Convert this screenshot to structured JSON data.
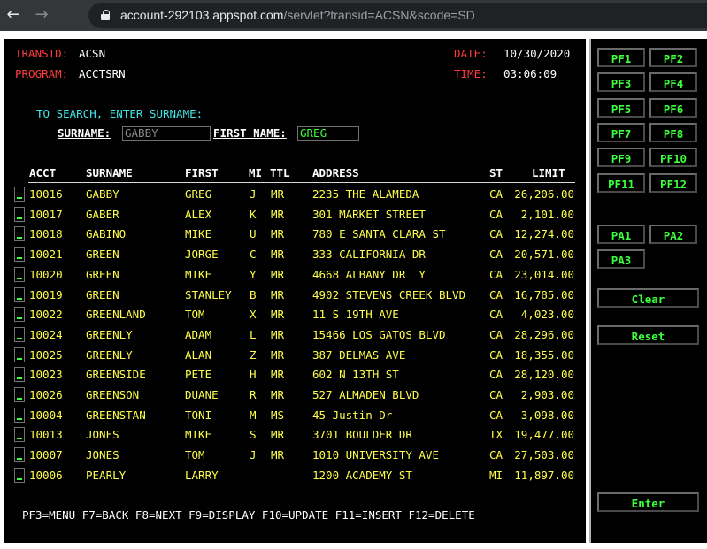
{
  "browser": {
    "back_icon": "←",
    "forward_icon": "→",
    "url_host": "account-292103.appspot.com",
    "url_path": "/servlet?transid=ACSN&scode=SD"
  },
  "screen": {
    "transid_label": "TRANSID:",
    "transid_value": "ACSN",
    "program_label": "PROGRAM:",
    "program_value": "ACCTSRN",
    "date_label": "DATE:",
    "date_value": "10/30/2020",
    "time_label": "TIME:",
    "time_value": "03:06:09",
    "instruction": "TO SEARCH, ENTER SURNAME:",
    "surname_label": "SURNAME:",
    "surname_value": "GABBY",
    "firstname_label": "FIRST NAME:",
    "firstname_value": "GREG",
    "columns": {
      "acct": "ACCT",
      "surname": "SURNAME",
      "first": "FIRST",
      "mi": "MI",
      "ttl": "TTL",
      "address": "ADDRESS",
      "st": "ST",
      "limit": "LIMIT"
    },
    "rows": [
      {
        "acct": "10016",
        "surname": "GABBY",
        "first": "GREG",
        "mi": "J",
        "ttl": "MR",
        "address": "2235 THE ALAMEDA",
        "st": "CA",
        "limit": "26,206.00"
      },
      {
        "acct": "10017",
        "surname": "GABER",
        "first": "ALEX",
        "mi": "K",
        "ttl": "MR",
        "address": "301 MARKET STREET",
        "st": "CA",
        "limit": "2,101.00"
      },
      {
        "acct": "10018",
        "surname": "GABINO",
        "first": "MIKE",
        "mi": "U",
        "ttl": "MR",
        "address": "780 E SANTA CLARA ST",
        "st": "CA",
        "limit": "12,274.00"
      },
      {
        "acct": "10021",
        "surname": "GREEN",
        "first": "JORGE",
        "mi": "C",
        "ttl": "MR",
        "address": "333 CALIFORNIA DR",
        "st": "CA",
        "limit": "20,571.00"
      },
      {
        "acct": "10020",
        "surname": "GREEN",
        "first": "MIKE",
        "mi": "Y",
        "ttl": "MR",
        "address": "4668 ALBANY DR  Y",
        "st": "CA",
        "limit": "23,014.00"
      },
      {
        "acct": "10019",
        "surname": "GREEN",
        "first": "STANLEY",
        "mi": "B",
        "ttl": "MR",
        "address": "4902 STEVENS CREEK BLVD",
        "st": "CA",
        "limit": "16,785.00"
      },
      {
        "acct": "10022",
        "surname": "GREENLAND",
        "first": "TOM",
        "mi": "X",
        "ttl": "MR",
        "address": "11 S 19TH AVE",
        "st": "CA",
        "limit": "4,023.00"
      },
      {
        "acct": "10024",
        "surname": "GREENLY",
        "first": "ADAM",
        "mi": "L",
        "ttl": "MR",
        "address": "15466 LOS GATOS BLVD",
        "st": "CA",
        "limit": "28,296.00"
      },
      {
        "acct": "10025",
        "surname": "GREENLY",
        "first": "ALAN",
        "mi": "Z",
        "ttl": "MR",
        "address": "387 DELMAS AVE",
        "st": "CA",
        "limit": "18,355.00"
      },
      {
        "acct": "10023",
        "surname": "GREENSIDE",
        "first": "PETE",
        "mi": "H",
        "ttl": "MR",
        "address": "602 N 13TH ST",
        "st": "CA",
        "limit": "28,120.00"
      },
      {
        "acct": "10026",
        "surname": "GREENSON",
        "first": "DUANE",
        "mi": "R",
        "ttl": "MR",
        "address": "527 ALMADEN BLVD",
        "st": "CA",
        "limit": "2,903.00"
      },
      {
        "acct": "10004",
        "surname": "GREENSTAN",
        "first": "TONI",
        "mi": "M",
        "ttl": "MS",
        "address": "45 Justin Dr",
        "st": "CA",
        "limit": "3,098.00"
      },
      {
        "acct": "10013",
        "surname": "JONES",
        "first": "MIKE",
        "mi": "S",
        "ttl": "MR",
        "address": "3701 BOULDER DR",
        "st": "TX",
        "limit": "19,477.00"
      },
      {
        "acct": "10007",
        "surname": "JONES",
        "first": "TOM",
        "mi": "J",
        "ttl": "MR",
        "address": "1010 UNIVERSITY AVE",
        "st": "CA",
        "limit": "27,503.00"
      },
      {
        "acct": "10006",
        "surname": "PEARLY",
        "first": "LARRY",
        "mi": "",
        "ttl": "",
        "address": "1200 ACADEMY ST",
        "st": "MI",
        "limit": "11,897.00"
      }
    ],
    "footer": "PF3=MENU F7=BACK F8=NEXT F9=DISPLAY F10=UPDATE F11=INSERT F12=DELETE"
  },
  "keys": {
    "pf": [
      "PF1",
      "PF2",
      "PF3",
      "PF4",
      "PF5",
      "PF6",
      "PF7",
      "PF8",
      "PF9",
      "PF10",
      "PF11",
      "PF12"
    ],
    "pa": [
      "PA1",
      "PA2",
      "PA3"
    ],
    "clear": "Clear",
    "reset": "Reset",
    "enter": "Enter"
  },
  "colors": {
    "label_red": "#ff3c3c",
    "value_white": "#ffffff",
    "prompt_cyan": "#3ee6e6",
    "data_yellow": "#ffff4a",
    "input_green": "#3bff3b"
  }
}
